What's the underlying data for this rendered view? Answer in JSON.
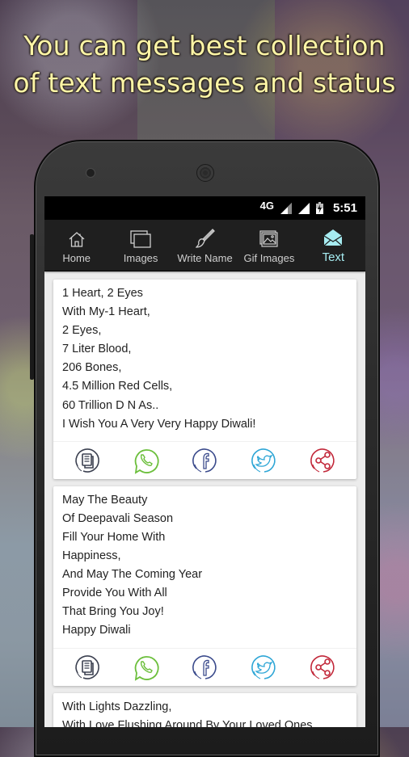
{
  "headline": {
    "line1": "You can get best collection",
    "line2": "of text messages and status"
  },
  "status_bar": {
    "network": "4G",
    "time": "5:51"
  },
  "tabs": [
    {
      "label": "Home",
      "icon": "home-icon",
      "active": false
    },
    {
      "label": "Images",
      "icon": "images-icon",
      "active": false
    },
    {
      "label": "Write Name",
      "icon": "brush-icon",
      "active": false
    },
    {
      "label": "Gif Images",
      "icon": "gallery-icon",
      "active": false
    },
    {
      "label": "Text",
      "icon": "envelope-icon",
      "active": true
    }
  ],
  "colors": {
    "active_tab": "#a6ecf1",
    "headline": "#fdf5a6",
    "copy": "#3b4050",
    "whatsapp": "#6cbf3c",
    "facebook": "#3b4b8c",
    "twitter": "#2ea6d6",
    "share": "#c2283a"
  },
  "actions": [
    {
      "name": "copy",
      "icon": "copy-icon"
    },
    {
      "name": "whatsapp",
      "icon": "whatsapp-icon"
    },
    {
      "name": "facebook",
      "icon": "facebook-icon"
    },
    {
      "name": "twitter",
      "icon": "twitter-icon"
    },
    {
      "name": "share",
      "icon": "share-icon"
    }
  ],
  "messages": [
    {
      "lines": [
        "1 Heart, 2 Eyes",
        "With My-1 Heart,",
        "2 Eyes,",
        "7 Liter Blood,",
        "206 Bones,",
        "4.5 Million Red Cells,",
        "60 Trillion D N As..",
        "I Wish You A Very Very Happy Diwali!"
      ]
    },
    {
      "lines": [
        "May The Beauty",
        "Of Deepavali Season",
        "Fill Your Home With",
        "Happiness,",
        "And May The Coming Year",
        "Provide You With All",
        "That Bring You Joy!",
        "Happy Diwali"
      ]
    },
    {
      "lines": [
        "With Lights Dazzling,",
        "With Love Flushing Around By Your Loved Ones"
      ]
    }
  ]
}
